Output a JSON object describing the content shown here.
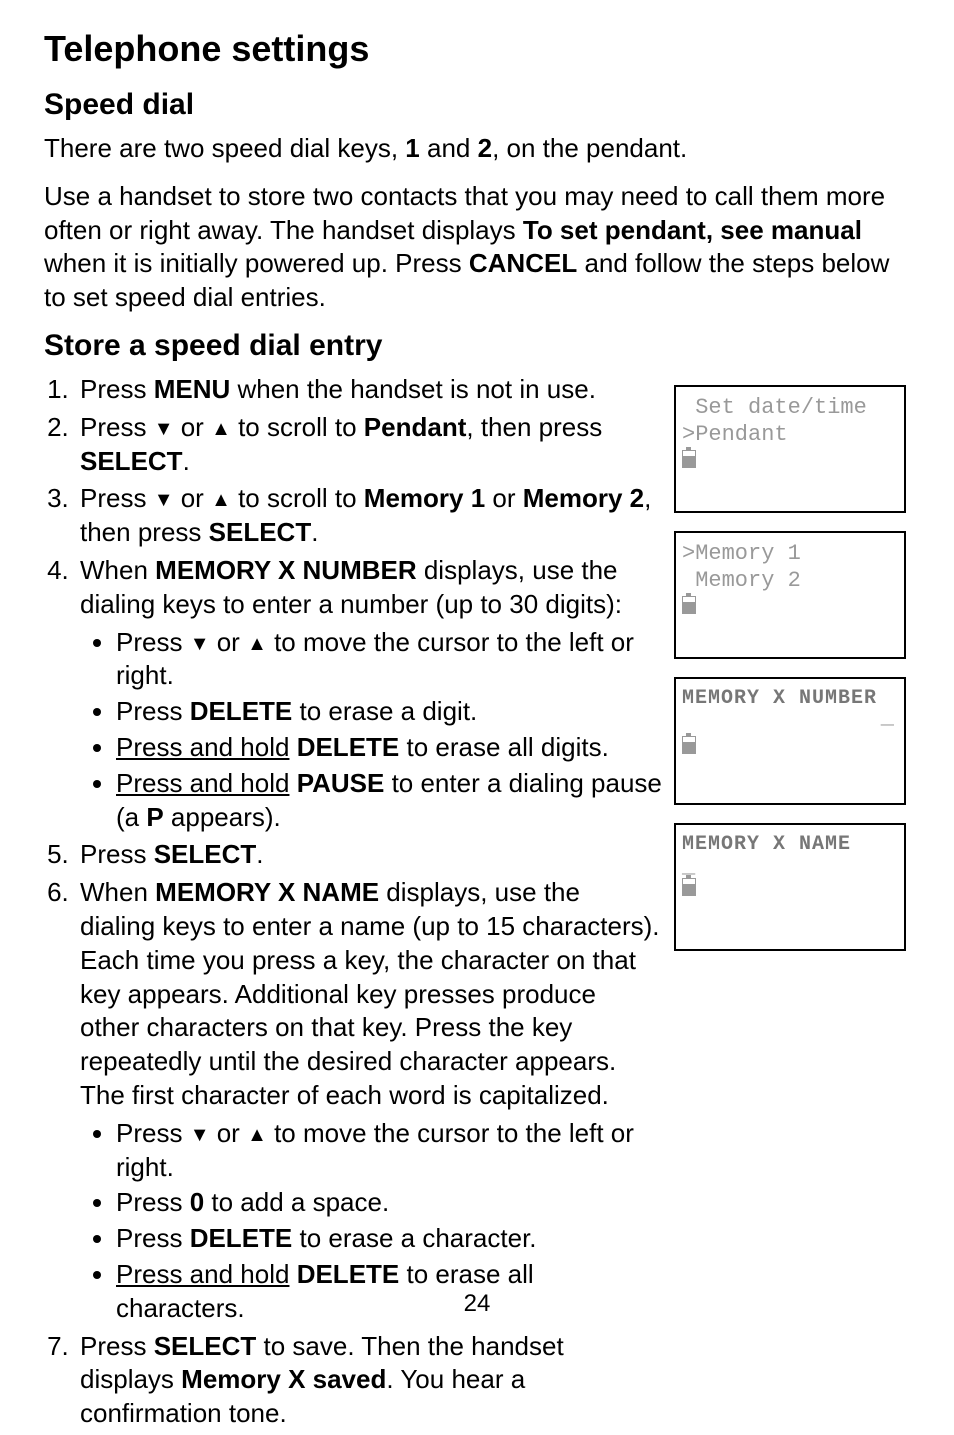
{
  "page": {
    "title": "Telephone settings",
    "page_number": "24"
  },
  "sections": {
    "speed_dial": {
      "heading": "Speed dial",
      "intro1_a": "There are two speed dial keys, ",
      "intro1_b1": "1",
      "intro1_c": " and ",
      "intro1_b2": "2",
      "intro1_d": ", on the pendant.",
      "intro2_a": "Use a handset to store two contacts that you may need to call them more often or right away. The handset displays ",
      "intro2_b": "To set pendant, see manual",
      "intro2_c": " when it is initially powered up. Press ",
      "intro2_d": "CANCEL",
      "intro2_e": " and follow the steps below to set speed dial entries."
    },
    "store": {
      "heading": "Store a speed dial entry",
      "steps": {
        "s1_a": "Press ",
        "s1_b": "MENU",
        "s1_c": " when the handset is not in use.",
        "s2_a": "Press ",
        "s2_b": " or ",
        "s2_c": " to scroll to ",
        "s2_d": "Pendant",
        "s2_e": ", then press ",
        "s2_f": "SELECT",
        "s2_g": ".",
        "s3_a": "Press ",
        "s3_b": " or ",
        "s3_c": " to scroll to ",
        "s3_d": "Memory 1",
        "s3_e": " or ",
        "s3_f": "Memory 2",
        "s3_g": ", then press ",
        "s3_h": "SELECT",
        "s3_i": ".",
        "s4_a": "When ",
        "s4_b": "MEMORY X NUMBER",
        "s4_c": " displays, use the dialing keys to enter a number (up to 30 digits):",
        "s4_sub": {
          "a1": "Press ",
          "a2": " or ",
          "a3": " to move the cursor to the left or right.",
          "b1": "Press ",
          "b2": "DELETE",
          "b3": " to erase a digit.",
          "c1": "Press and hold",
          "c2": " ",
          "c3": "DELETE",
          "c4": " to erase all digits.",
          "d1": "Press and hold",
          "d2": " ",
          "d3": "PAUSE",
          "d4": " to enter a dialing pause (a ",
          "d5": "P",
          "d6": " appears)."
        },
        "s5_a": "Press ",
        "s5_b": "SELECT",
        "s5_c": ".",
        "s6_a": "When ",
        "s6_b": "MEMORY X NAME",
        "s6_c": " displays, use the dialing keys to enter a name (up to 15 characters). Each time you press a key, the character on that key appears. Additional key presses produce other characters on that key. Press the key repeatedly until the desired character appears. The first character of each word is capitalized.",
        "s6_sub": {
          "a1": "Press ",
          "a2": " or ",
          "a3": " to move the cursor to the left or right.",
          "b1": "Press ",
          "b2": "0",
          "b3": " to add a space.",
          "c1": "Press ",
          "c2": "DELETE",
          "c3": " to erase a character.",
          "d1": "Press and hold",
          "d2": " ",
          "d3": "DELETE",
          "d4": " to erase all characters."
        },
        "s7_a": "Press ",
        "s7_b": "SELECT",
        "s7_c": " to save. Then the handset displays ",
        "s7_d": "Memory X saved",
        "s7_e": ". You hear a confirmation tone."
      }
    }
  },
  "screens": {
    "s1": {
      "line1": " Set date/time",
      "line2": ">Pendant"
    },
    "s2": {
      "line1": ">Memory 1",
      "line2": " Memory 2"
    },
    "s3": {
      "line1": "MEMORY X NUMBER",
      "cursor": "_"
    },
    "s4": {
      "line1": "MEMORY X NAME",
      "cursor": "_"
    }
  },
  "glyphs": {
    "down": "▼",
    "up": "▲"
  }
}
